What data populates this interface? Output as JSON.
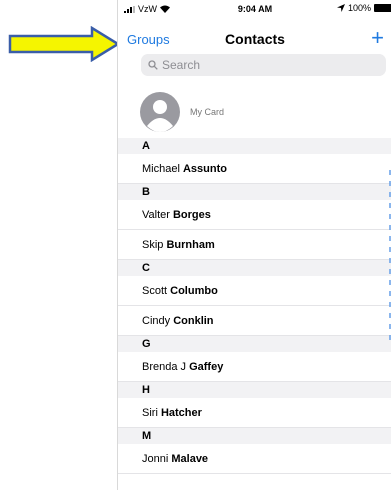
{
  "status_bar": {
    "carrier": "VzW",
    "time": "9:04 AM",
    "battery": "100%"
  },
  "nav": {
    "groups_label": "Groups",
    "title": "Contacts",
    "add_label": "+"
  },
  "search": {
    "placeholder": "Search"
  },
  "my_card": {
    "label": "My Card"
  },
  "sections": [
    {
      "letter": "A",
      "contacts": [
        {
          "first": "Michael",
          "last": "Assunto"
        }
      ]
    },
    {
      "letter": "B",
      "contacts": [
        {
          "first": "Valter",
          "last": "Borges"
        },
        {
          "first": "Skip",
          "last": "Burnham"
        }
      ]
    },
    {
      "letter": "C",
      "contacts": [
        {
          "first": "Scott",
          "last": "Columbo"
        },
        {
          "first": "Cindy",
          "last": "Conklin"
        }
      ]
    },
    {
      "letter": "G",
      "contacts": [
        {
          "first": "Brenda J",
          "last": "Gaffey"
        }
      ]
    },
    {
      "letter": "H",
      "contacts": [
        {
          "first": "Siri",
          "last": "Hatcher"
        }
      ]
    },
    {
      "letter": "M",
      "contacts": [
        {
          "first": "Jonni",
          "last": "Malave"
        }
      ]
    }
  ],
  "annotation": {
    "arrow_color": "#f5f500",
    "arrow_outline": "#3a5ea8"
  },
  "colors": {
    "accent": "#1f7ae0",
    "section_bg": "#f2f2f4"
  }
}
